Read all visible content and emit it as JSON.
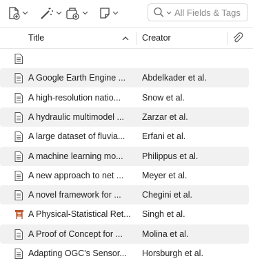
{
  "toolbar": {
    "new_item_icon": "new-item-icon",
    "magic_wand_icon": "add-by-identifier-icon",
    "attach_icon": "add-attachment-icon",
    "note_icon": "new-note-icon",
    "search_placeholder": "All Fields & Tags"
  },
  "columns": {
    "title": "Title",
    "creator": "Creator",
    "attachment_icon": "paperclip-icon"
  },
  "rows": [
    {
      "type": "document",
      "title": "",
      "creator": ""
    },
    {
      "type": "document",
      "title": "A Google Earth Engine ...",
      "creator": "Abdelkader et al."
    },
    {
      "type": "document",
      "title": "A high-resolution natio...",
      "creator": "Snow et al."
    },
    {
      "type": "document",
      "title": "A hydraulic multimodel ...",
      "creator": "Zarzar et al."
    },
    {
      "type": "document",
      "title": "A large dataset of fluvia...",
      "creator": "Erfani et al."
    },
    {
      "type": "document",
      "title": "A machine learning mo...",
      "creator": "Philippus et al."
    },
    {
      "type": "document",
      "title": "A new approach to net ...",
      "creator": "Meyer et al."
    },
    {
      "type": "document",
      "title": "A novel framework for ...",
      "creator": "Chegini et al."
    },
    {
      "type": "presentation",
      "title": "A Physical-Statistical Ret...",
      "creator": "Singh et al."
    },
    {
      "type": "document",
      "title": "A Proof of Concept for ...",
      "creator": "Molina et al."
    },
    {
      "type": "document",
      "title": "Adapting OGC's Sensor...",
      "creator": "Horsburgh et al."
    }
  ],
  "colors": {
    "row_alt": "#f1f1f2",
    "presentation_icon": "#c0562a"
  }
}
